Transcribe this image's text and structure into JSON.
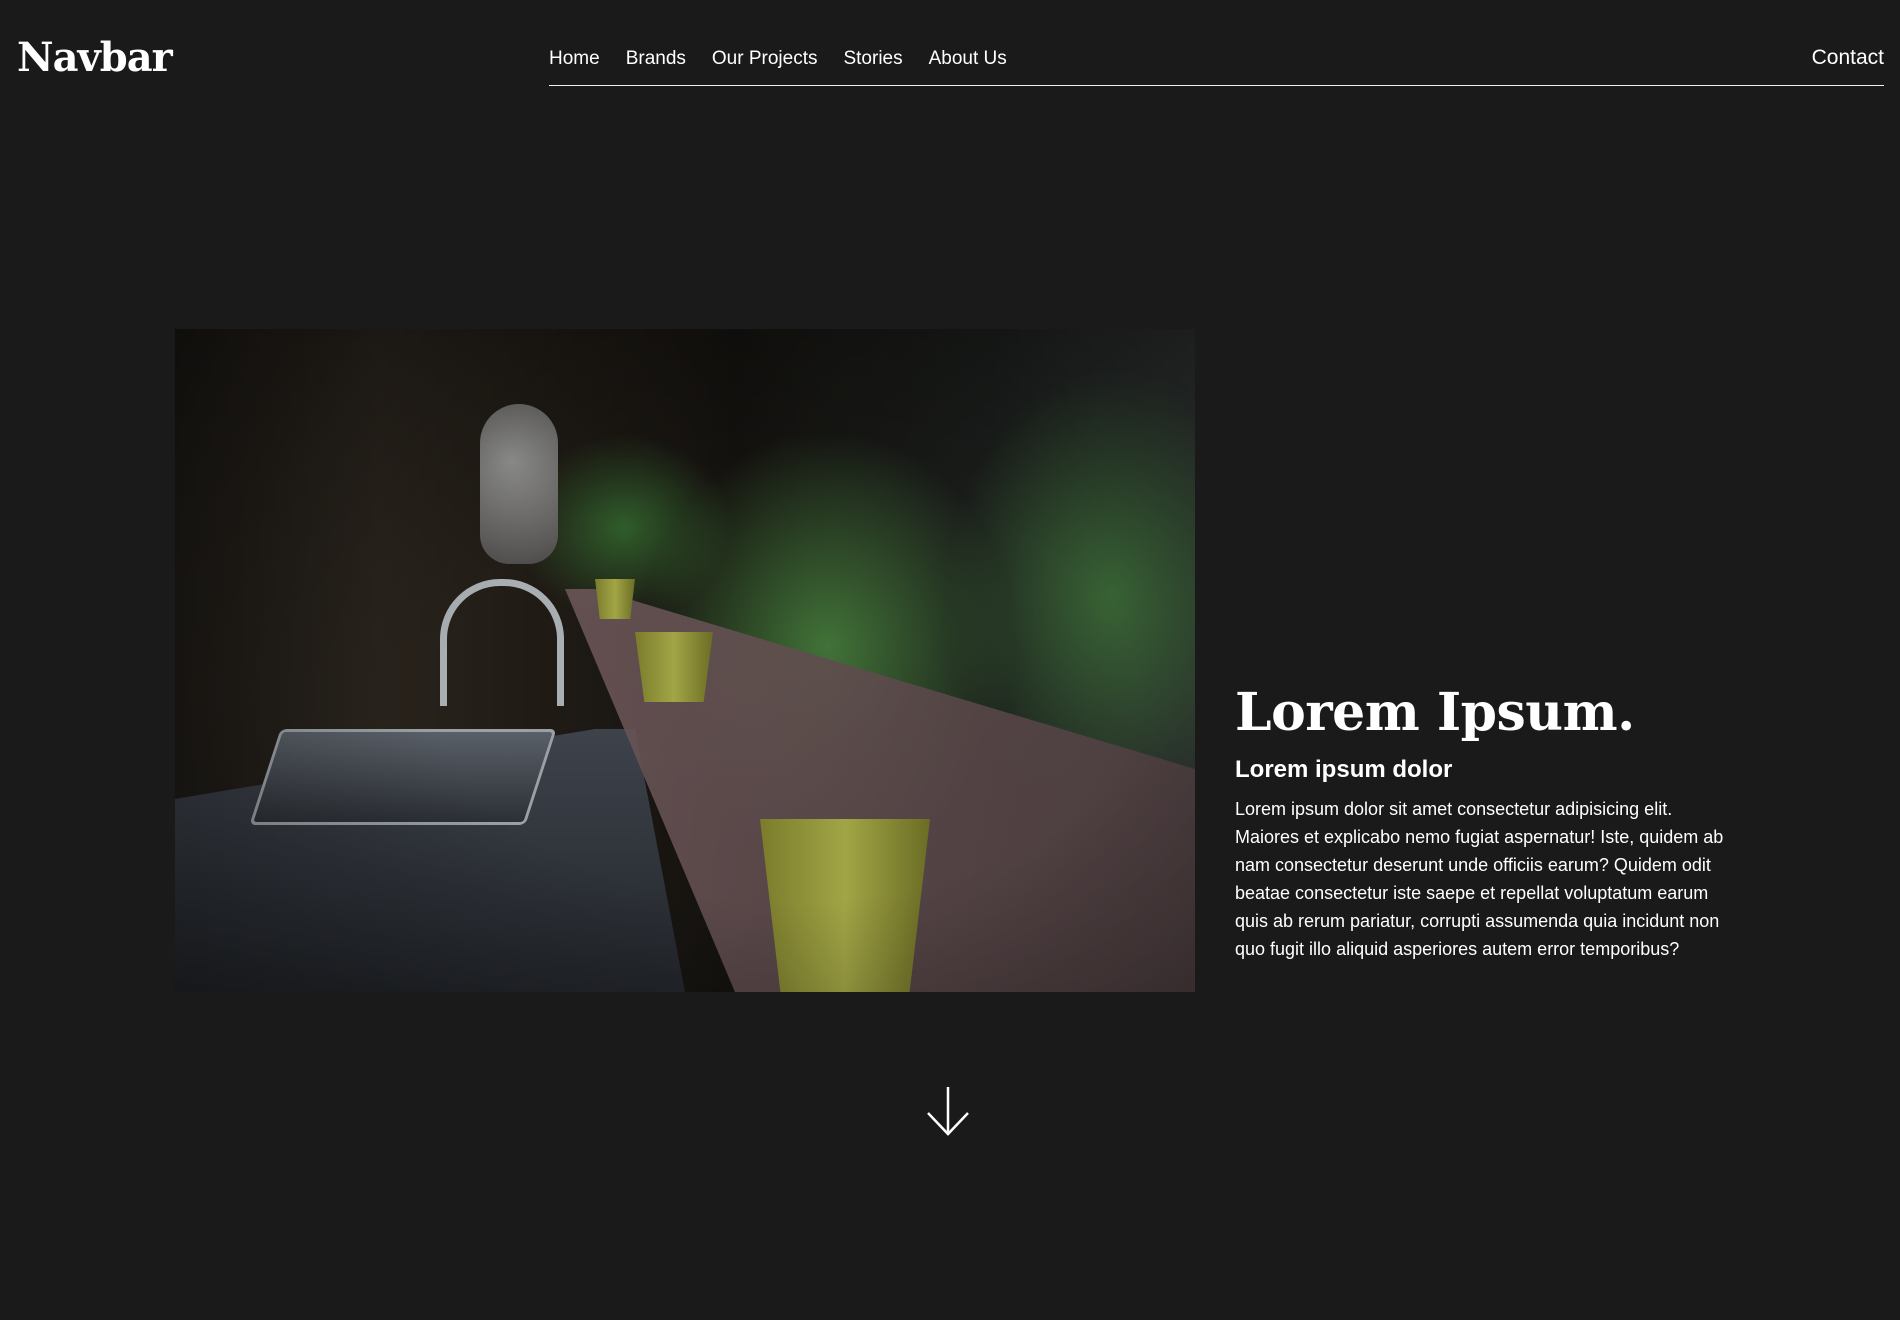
{
  "navbar": {
    "brand": "Navbar",
    "items": [
      {
        "label": "Home"
      },
      {
        "label": "Brands"
      },
      {
        "label": "Our Projects"
      },
      {
        "label": "Stories"
      },
      {
        "label": "About Us"
      }
    ],
    "contact": "Contact"
  },
  "hero": {
    "title": "Lorem Ipsum.",
    "subtitle": "Lorem ipsum dolor",
    "body": "Lorem ipsum dolor sit amet consectetur adipisicing elit. Maiores et explicabo nemo fugiat aspernatur! Iste, quidem ab nam consectetur deserunt unde officiis earum? Quidem odit beatae consectetur iste saepe et repellat voluptatum earum quis ab rerum pariatur, corrupti assumenda quia incidunt non quo fugit illo aliquid asperiores autem error temporibus?"
  },
  "icons": {
    "scroll": "arrow-down-icon"
  },
  "colors": {
    "background": "#1a1a1a",
    "text": "#ffffff"
  }
}
